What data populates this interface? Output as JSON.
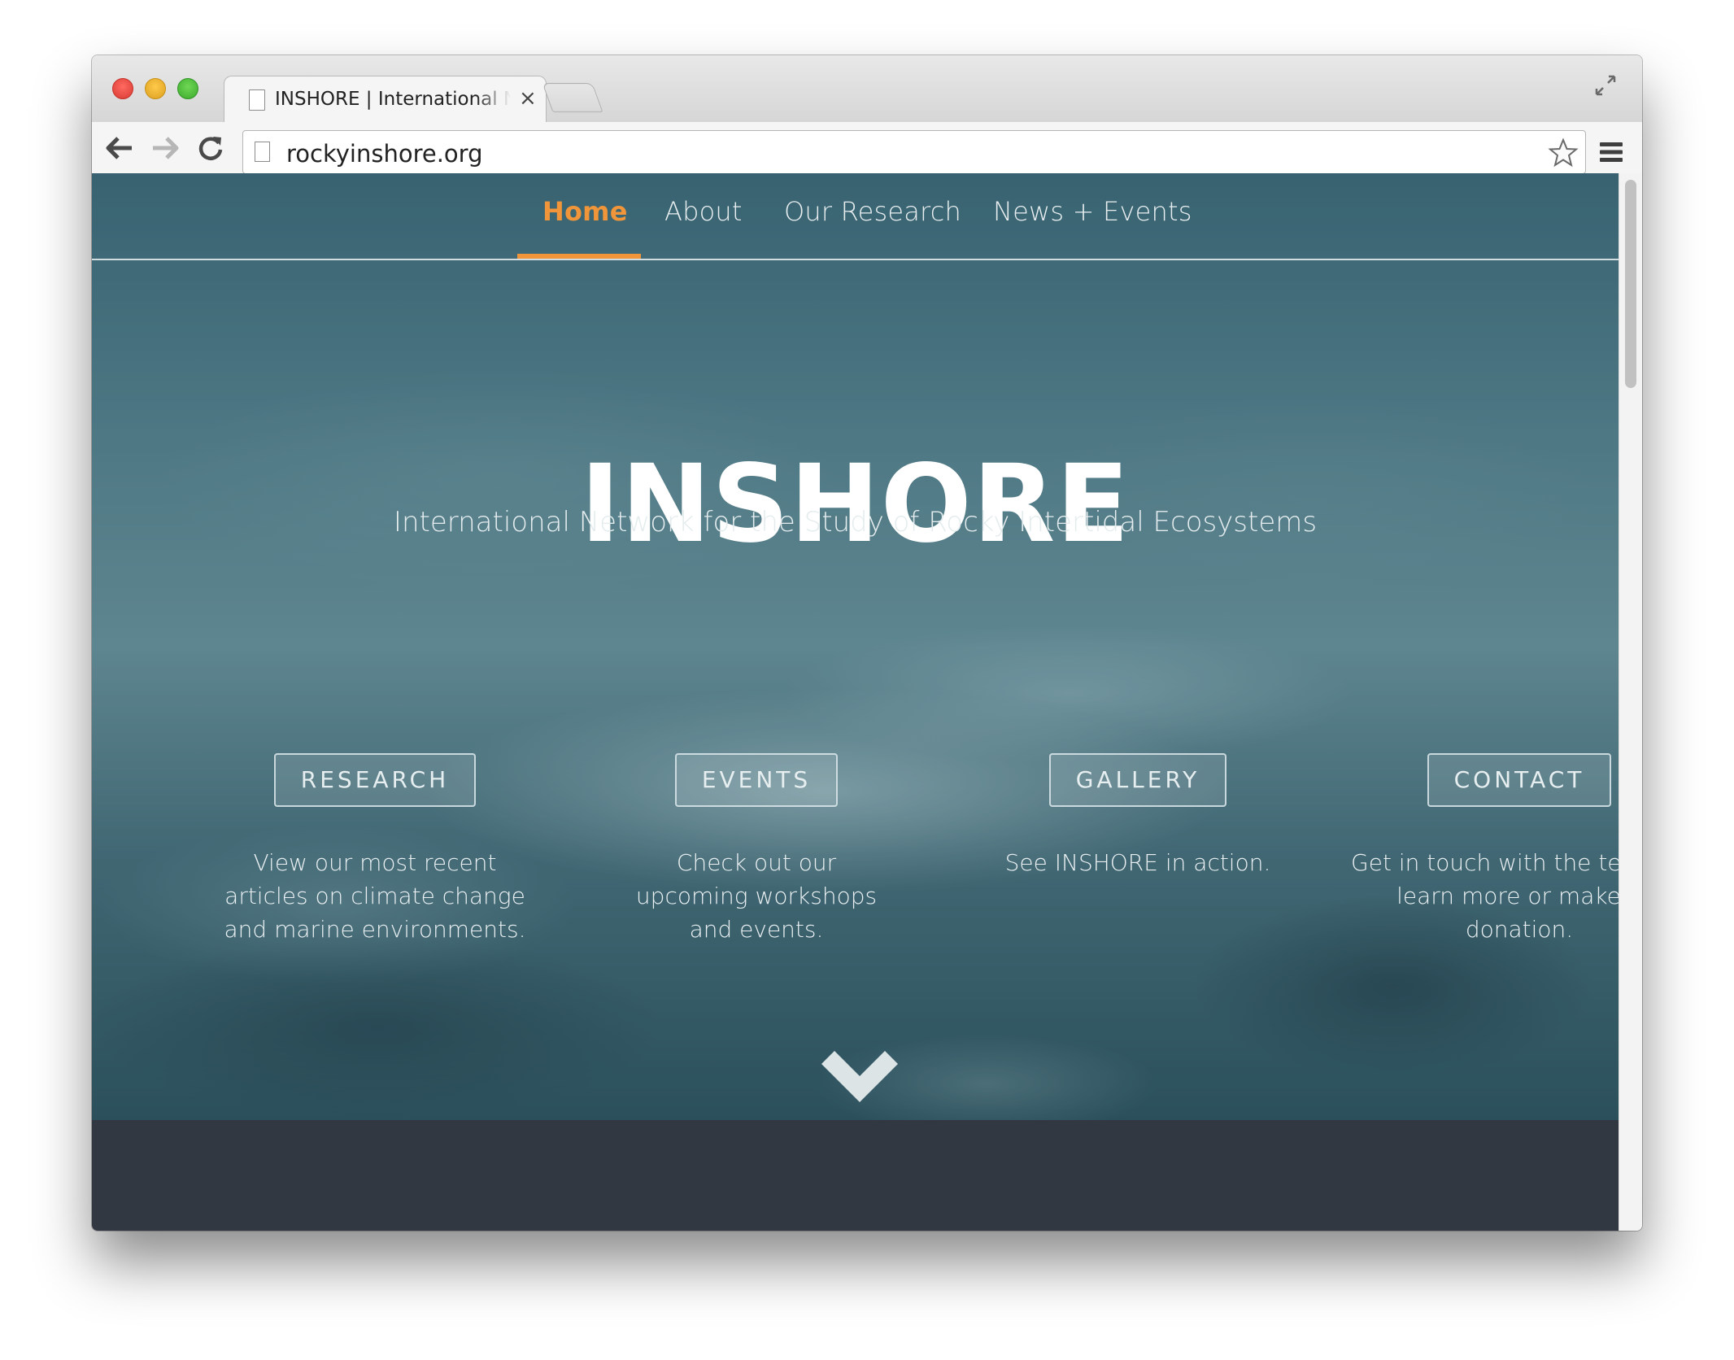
{
  "browser": {
    "tab_title": "INSHORE | International Network for the Study of Rocky Intertidal Ecosystems",
    "tab_close": "×",
    "url": "rockyinshore.org"
  },
  "nav": {
    "items": [
      {
        "label": "Home",
        "active": true
      },
      {
        "label": "About",
        "active": false
      },
      {
        "label": "Our Research",
        "active": false
      },
      {
        "label": "News + Events",
        "active": false
      }
    ]
  },
  "hero": {
    "title": "INSHORE",
    "subtitle": "International Network for the Study of Rocky Intertidal Ecosystems"
  },
  "features": [
    {
      "button": "RESEARCH",
      "description": "View our most recent articles on climate change and marine environments."
    },
    {
      "button": "EVENTS",
      "description": "Check out our upcoming workshops and events."
    },
    {
      "button": "GALLERY",
      "description": "See INSHORE in action."
    },
    {
      "button": "CONTACT",
      "description": "Get in touch with the team to learn more or make a donation."
    }
  ],
  "icons": [
    "back-arrow-icon",
    "forward-arrow-icon",
    "reload-icon",
    "page-icon",
    "star-icon",
    "menu-icon",
    "fullscreen-icon",
    "chevron-down-icon"
  ],
  "colors": {
    "accent": "#f0953a",
    "dark_band": "#313842"
  }
}
